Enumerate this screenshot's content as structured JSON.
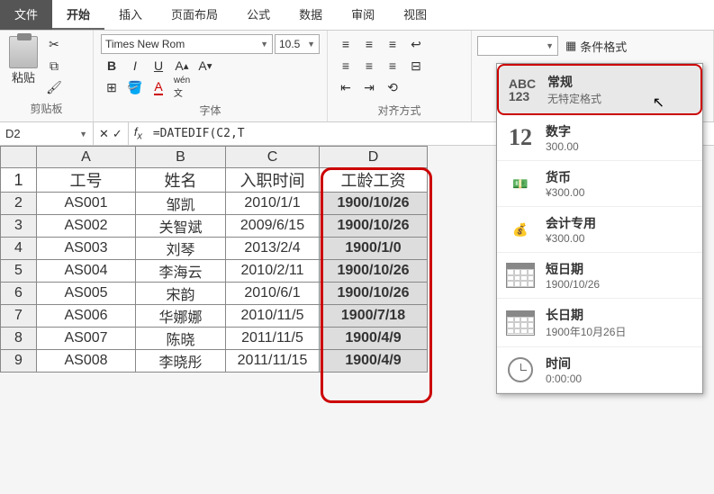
{
  "tabs": {
    "file": "文件",
    "home": "开始",
    "insert": "插入",
    "layout": "页面布局",
    "formula": "公式",
    "data": "数据",
    "review": "审阅",
    "view": "视图"
  },
  "ribbon": {
    "paste": "粘贴",
    "clipboard_label": "剪贴板",
    "font_name": "Times New Rom",
    "font_size": "10.5",
    "font_label": "字体",
    "align_label": "对齐方式",
    "cond_format": "条件格式"
  },
  "dropdown": {
    "general": {
      "title": "常规",
      "sub": "无特定格式"
    },
    "number": {
      "title": "数字",
      "sub": "300.00",
      "icon": "12"
    },
    "currency": {
      "title": "货币",
      "sub": "¥300.00"
    },
    "accounting": {
      "title": "会计专用",
      "sub": "¥300.00"
    },
    "shortdate": {
      "title": "短日期",
      "sub": "1900/10/26"
    },
    "longdate": {
      "title": "长日期",
      "sub": "1900年10月26日"
    },
    "time": {
      "title": "时间",
      "sub": "0:00:00"
    }
  },
  "cellref": {
    "name": "D2",
    "formula": "=DATEDIF(C2,T"
  },
  "columns": [
    "A",
    "B",
    "C",
    "D"
  ],
  "headers": {
    "A": "工号",
    "B": "姓名",
    "C": "入职时间",
    "D": "工龄工资"
  },
  "rows": [
    {
      "n": "2",
      "A": "AS001",
      "B": "邹凯",
      "C": "2010/1/1",
      "D": "1900/10/26"
    },
    {
      "n": "3",
      "A": "AS002",
      "B": "关智斌",
      "C": "2009/6/15",
      "D": "1900/10/26"
    },
    {
      "n": "4",
      "A": "AS003",
      "B": "刘琴",
      "C": "2013/2/4",
      "D": "1900/1/0"
    },
    {
      "n": "5",
      "A": "AS004",
      "B": "李海云",
      "C": "2010/2/11",
      "D": "1900/10/26"
    },
    {
      "n": "6",
      "A": "AS005",
      "B": "宋韵",
      "C": "2010/6/1",
      "D": "1900/10/26"
    },
    {
      "n": "7",
      "A": "AS006",
      "B": "华娜娜",
      "C": "2010/11/5",
      "D": "1900/7/18"
    },
    {
      "n": "8",
      "A": "AS007",
      "B": "陈晓",
      "C": "2011/11/5",
      "D": "1900/4/9"
    },
    {
      "n": "9",
      "A": "AS008",
      "B": "李晓彤",
      "C": "2011/11/15",
      "D": "1900/4/9"
    }
  ],
  "chart_data": {
    "type": "table",
    "title": "工龄工资",
    "columns": [
      "工号",
      "姓名",
      "入职时间",
      "工龄工资"
    ],
    "data": [
      [
        "AS001",
        "邹凯",
        "2010/1/1",
        "1900/10/26"
      ],
      [
        "AS002",
        "关智斌",
        "2009/6/15",
        "1900/10/26"
      ],
      [
        "AS003",
        "刘琴",
        "2013/2/4",
        "1900/1/0"
      ],
      [
        "AS004",
        "李海云",
        "2010/2/11",
        "1900/10/26"
      ],
      [
        "AS005",
        "宋韵",
        "2010/6/1",
        "1900/10/26"
      ],
      [
        "AS006",
        "华娜娜",
        "2010/11/5",
        "1900/7/18"
      ],
      [
        "AS007",
        "陈晓",
        "2011/11/5",
        "1900/4/9"
      ],
      [
        "AS008",
        "李晓彤",
        "2011/11/15",
        "1900/4/9"
      ]
    ]
  }
}
